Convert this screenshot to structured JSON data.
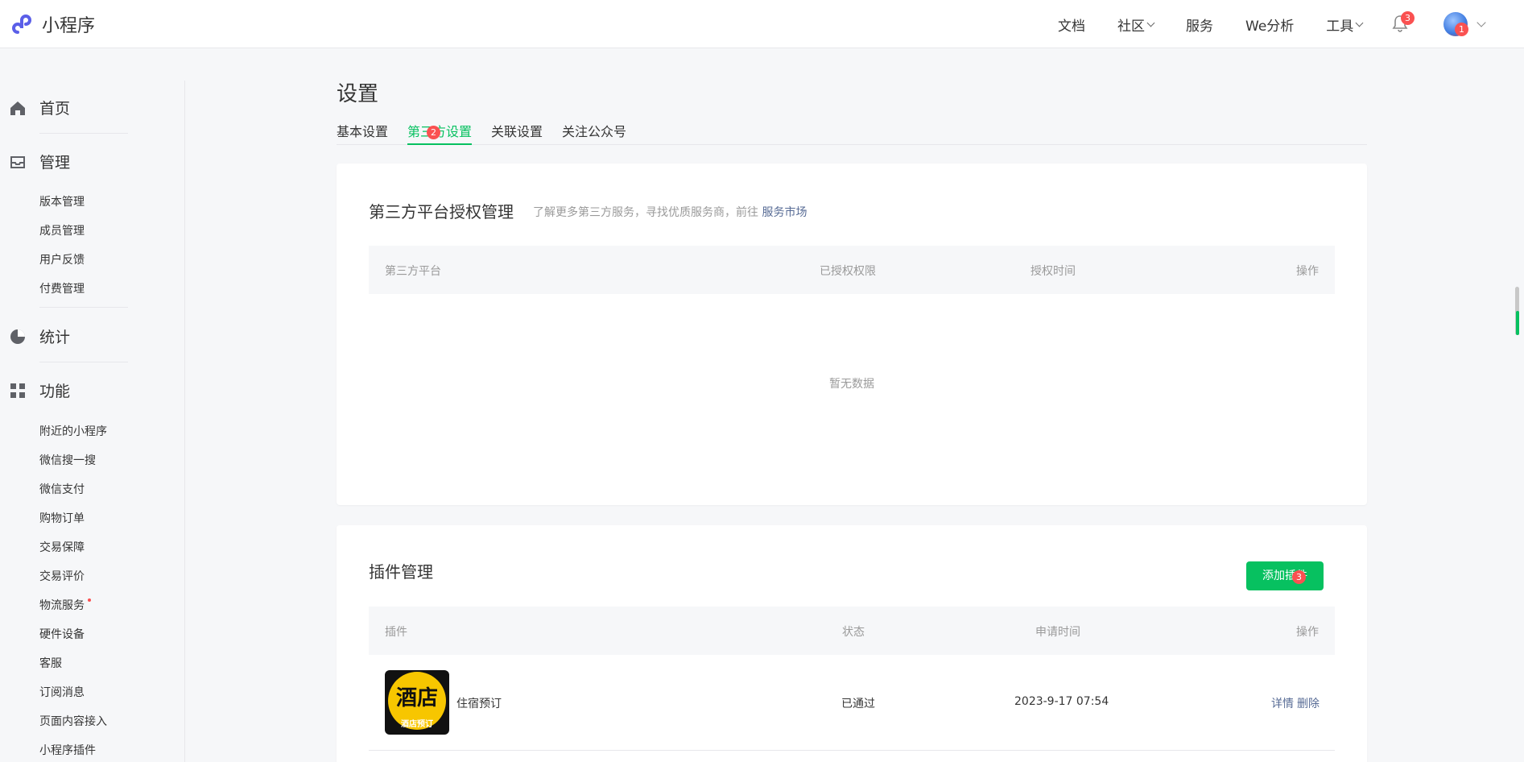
{
  "header": {
    "app_name": "小程序",
    "nav": [
      {
        "label": "文档",
        "dropdown": false
      },
      {
        "label": "社区",
        "dropdown": true
      },
      {
        "label": "服务",
        "dropdown": false
      },
      {
        "label": "We分析",
        "dropdown": false
      },
      {
        "label": "工具",
        "dropdown": true
      }
    ],
    "notification_count": "3",
    "avatar_badge": "1"
  },
  "sidebar": {
    "home": "首页",
    "manage": "管理",
    "manage_items": [
      "版本管理",
      "成员管理",
      "用户反馈",
      "付费管理"
    ],
    "stats": "统计",
    "features": "功能",
    "feature_items": [
      "附近的小程序",
      "微信搜一搜",
      "微信支付",
      "购物订单",
      "交易保障",
      "交易评价",
      "物流服务",
      "硬件设备",
      "客服",
      "订阅消息",
      "页面内容接入",
      "小程序插件"
    ]
  },
  "main": {
    "title": "设置",
    "tabs": [
      "基本设置",
      "第三方设置",
      "关联设置",
      "关注公众号"
    ],
    "active_tab_badge": "2",
    "third_party": {
      "title": "第三方平台授权管理",
      "desc": "了解更多第三方服务，寻找优质服务商，前往",
      "desc_link": "服务市场",
      "columns": [
        "第三方平台",
        "已授权权限",
        "授权时间",
        "操作"
      ],
      "empty": "暂无数据"
    },
    "plugins": {
      "title": "插件管理",
      "add_button": "添加插件",
      "add_badge": "3",
      "columns": [
        "插件",
        "状态",
        "申请时间",
        "操作"
      ],
      "rows": [
        {
          "logo_text": "酒店",
          "logo_sub": "酒店预订",
          "name": "住宿预订",
          "status": "已通过",
          "time": "2023-9-17 07:54",
          "action_detail": "详情",
          "action_delete": "删除"
        }
      ]
    }
  },
  "colors": {
    "accent": "#07c160",
    "link": "#576b95",
    "badge": "#fa5151"
  }
}
